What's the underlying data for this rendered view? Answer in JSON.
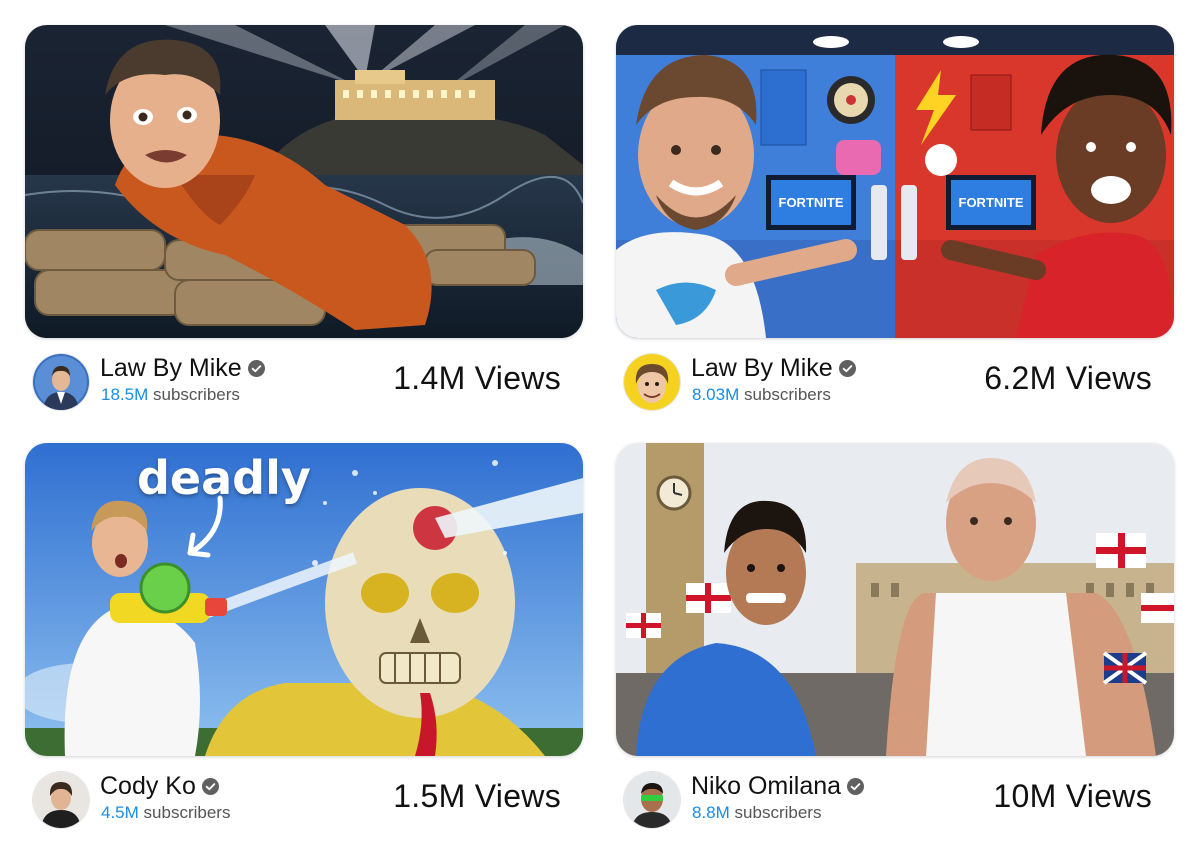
{
  "cards": [
    {
      "channel": "Law By Mike",
      "subscribers_count": "18.5M",
      "subscribers_label": "subscribers",
      "views": "1.4M Views",
      "verified": true
    },
    {
      "channel": "Law By Mike",
      "subscribers_count": "8.03M",
      "subscribers_label": "subscribers",
      "views": "6.2M Views",
      "verified": true,
      "thumb_text": [
        "FORTNITE",
        "FORTNITE"
      ]
    },
    {
      "channel": "Cody Ko",
      "subscribers_count": "4.5M",
      "subscribers_label": "subscribers",
      "views": "1.5M Views",
      "verified": true,
      "thumb_text": "deadly"
    },
    {
      "channel": "Niko Omilana",
      "subscribers_count": "8.8M",
      "subscribers_label": "subscribers",
      "views": "10M Views",
      "verified": true
    }
  ],
  "colors": {
    "accent_subscribers": "#1a8ce6",
    "verified_badge": "#606060"
  },
  "icons": [
    "verified-check-icon",
    "arrow-icon"
  ]
}
